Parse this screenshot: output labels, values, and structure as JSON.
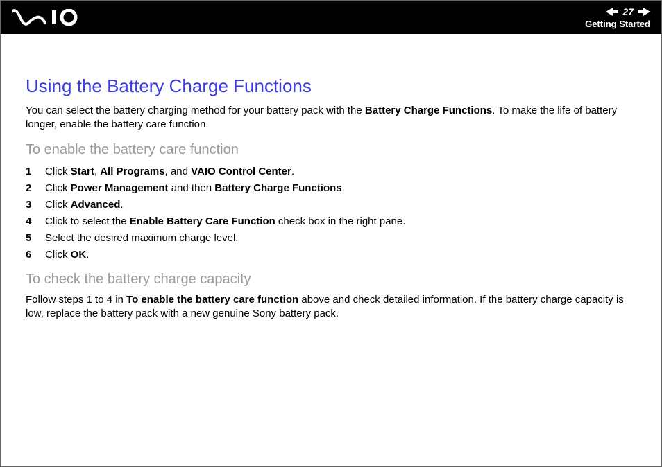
{
  "header": {
    "page_number": "27",
    "section": "Getting Started"
  },
  "title": "Using the Battery Charge Functions",
  "intro": {
    "pre": "You can select the battery charging method for your battery pack with the ",
    "bold": "Battery Charge Functions",
    "post": ". To make the life of battery longer, enable the battery care function."
  },
  "sub1": "To enable the battery care function",
  "steps": [
    {
      "n": "1",
      "parts": [
        {
          "t": "Click "
        },
        {
          "b": "Start"
        },
        {
          "t": ", "
        },
        {
          "b": "All Programs"
        },
        {
          "t": ", and "
        },
        {
          "b": "VAIO Control Center"
        },
        {
          "t": "."
        }
      ]
    },
    {
      "n": "2",
      "parts": [
        {
          "t": "Click "
        },
        {
          "b": "Power Management"
        },
        {
          "t": " and then "
        },
        {
          "b": "Battery Charge Functions"
        },
        {
          "t": "."
        }
      ]
    },
    {
      "n": "3",
      "parts": [
        {
          "t": "Click "
        },
        {
          "b": "Advanced"
        },
        {
          "t": "."
        }
      ]
    },
    {
      "n": "4",
      "parts": [
        {
          "t": "Click to select the "
        },
        {
          "b": "Enable Battery Care Function"
        },
        {
          "t": " check box in the right pane."
        }
      ]
    },
    {
      "n": "5",
      "parts": [
        {
          "t": "Select the desired maximum charge level."
        }
      ]
    },
    {
      "n": "6",
      "parts": [
        {
          "t": "Click "
        },
        {
          "b": "OK"
        },
        {
          "t": "."
        }
      ]
    }
  ],
  "sub2": "To check the battery charge capacity",
  "follow": {
    "pre": "Follow steps 1 to 4 in ",
    "bold": "To enable the battery care function",
    "post": " above and check detailed information. If the battery charge capacity is low, replace the battery pack with a new genuine Sony battery pack."
  }
}
